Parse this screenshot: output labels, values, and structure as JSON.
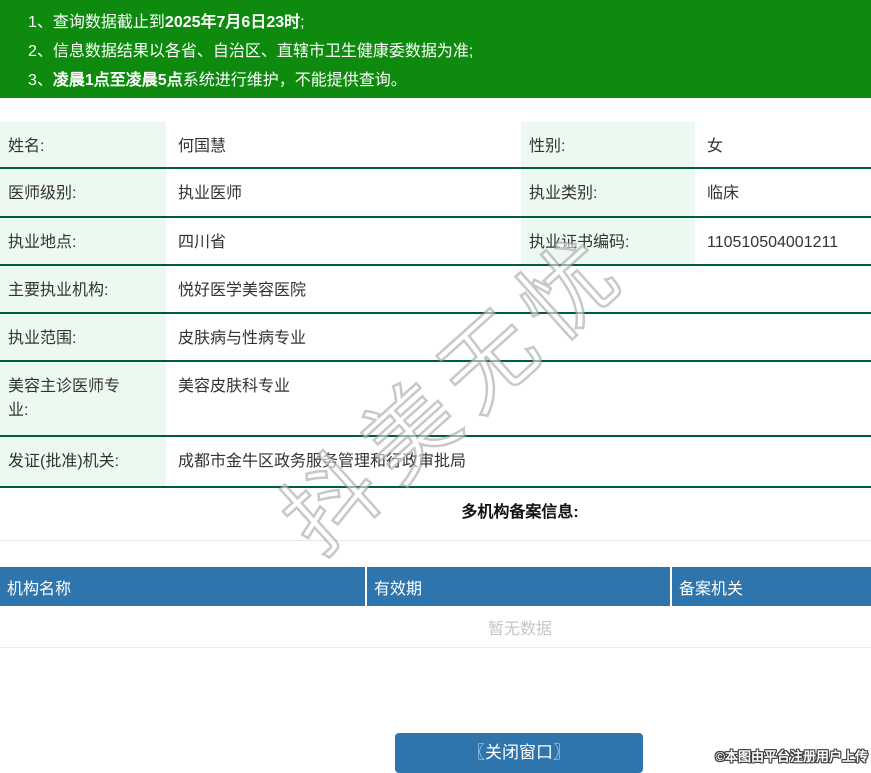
{
  "colors": {
    "banner_green": "#0e8b0e",
    "table_border_green": "#015b40",
    "label_cell_bg": "#ecf9f1",
    "header_blue": "#2e75ad",
    "button_blue": "#2e75ad",
    "empty_text_gray": "#c6c6c6"
  },
  "notice": {
    "items": [
      {
        "num": "1、",
        "pre": "查询数据截止到",
        "bold": "2025年7月6日23时",
        "post": ";"
      },
      {
        "num": "2、",
        "pre": "信息数据结果以各省、自治区、直辖市卫生健康委数据为准;",
        "bold": "",
        "post": ""
      },
      {
        "num": "3、",
        "pre": "",
        "bold": "凌晨1点至凌晨5点",
        "post": "系统进行维护，不能提供查询。"
      }
    ]
  },
  "info": {
    "rows": [
      {
        "label": "姓名:",
        "value": "何国慧",
        "label2": "性别:",
        "value2": "女"
      },
      {
        "label": "医师级别:",
        "value": "执业医师",
        "label2": "执业类别:",
        "value2": "临床"
      },
      {
        "label": "执业地点:",
        "value": "四川省",
        "label2": "执业证书编码:",
        "value2": "110510504001211"
      },
      {
        "label": "主要执业机构:",
        "value": "悦好医学美容医院"
      },
      {
        "label": "执业范围:",
        "value": "皮肤病与性病专业"
      },
      {
        "label": "美容主诊医师专\n业:",
        "value": "美容皮肤科专业"
      },
      {
        "label": "发证(批准)机关:",
        "value": "成都市金牛区政务服务管理和行政审批局"
      }
    ]
  },
  "multi_org": {
    "title": "多机构备案信息:",
    "headers": [
      "机构名称",
      "有效期",
      "备案机关"
    ],
    "empty_text": "暂无数据"
  },
  "button": {
    "close_label": "〖关闭窗口〗"
  },
  "watermark": {
    "text": "抖美无忧"
  },
  "footer": {
    "credit": "©本图由平台注册用户上传"
  }
}
